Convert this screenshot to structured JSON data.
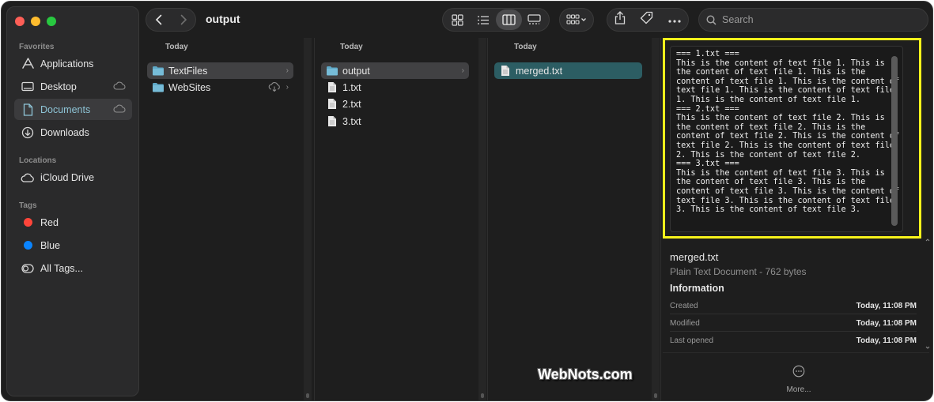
{
  "window": {
    "title": "output"
  },
  "toolbar": {
    "search_placeholder": "Search"
  },
  "sidebar": {
    "favorites_title": "Favorites",
    "favorites": [
      {
        "label": "Applications",
        "icon": "applications-icon"
      },
      {
        "label": "Desktop",
        "icon": "desktop-icon",
        "cloud": true
      },
      {
        "label": "Documents",
        "icon": "document-icon",
        "cloud": true,
        "selected": true
      },
      {
        "label": "Downloads",
        "icon": "download-icon"
      }
    ],
    "locations_title": "Locations",
    "locations": [
      {
        "label": "iCloud Drive",
        "icon": "icloud-icon"
      }
    ],
    "tags_title": "Tags",
    "tags": [
      {
        "label": "Red",
        "color": "#ff453a"
      },
      {
        "label": "Blue",
        "color": "#0a84ff"
      },
      {
        "label": "All Tags...",
        "icon": "all-tags-icon"
      }
    ]
  },
  "columns": [
    {
      "header": "Today",
      "items": [
        {
          "name": "TextFiles",
          "type": "folder",
          "selected": true
        },
        {
          "name": "WebSites",
          "type": "folder",
          "cloud": true
        }
      ]
    },
    {
      "header": "Today",
      "items": [
        {
          "name": "output",
          "type": "folder",
          "selected": true
        },
        {
          "name": "1.txt",
          "type": "file"
        },
        {
          "name": "2.txt",
          "type": "file"
        },
        {
          "name": "3.txt",
          "type": "file"
        }
      ]
    },
    {
      "header": "Today",
      "items": [
        {
          "name": "merged.txt",
          "type": "file",
          "selected": true
        }
      ]
    }
  ],
  "preview": {
    "content": "=== 1.txt ===\nThis is the content of text file 1. This is the content of text file 1. This is the content of text file 1. This is the content of text file 1. This is the content of text file 1. This is the content of text file 1.\n=== 2.txt ===\nThis is the content of text file 2. This is the content of text file 2. This is the content of text file 2. This is the content of text file 2. This is the content of text file 2. This is the content of text file 2.\n=== 3.txt ===\nThis is the content of text file 3. This is the content of text file 3. This is the content of text file 3. This is the content of text file 3. This is the content of text file 3. This is the content of text file 3."
  },
  "info": {
    "name": "merged.txt",
    "kind": "Plain Text Document - 762 bytes",
    "heading": "Information",
    "rows": [
      {
        "label": "Created",
        "value": "Today, 11:08 PM"
      },
      {
        "label": "Modified",
        "value": "Today, 11:08 PM"
      },
      {
        "label": "Last opened",
        "value": "Today, 11:08 PM"
      }
    ],
    "more_label": "More..."
  },
  "watermark": "WebNots.com",
  "colors": {
    "accent": "#8ec4d6",
    "selection_teal": "#2c5d63",
    "highlight_border": "#f7f31b"
  }
}
